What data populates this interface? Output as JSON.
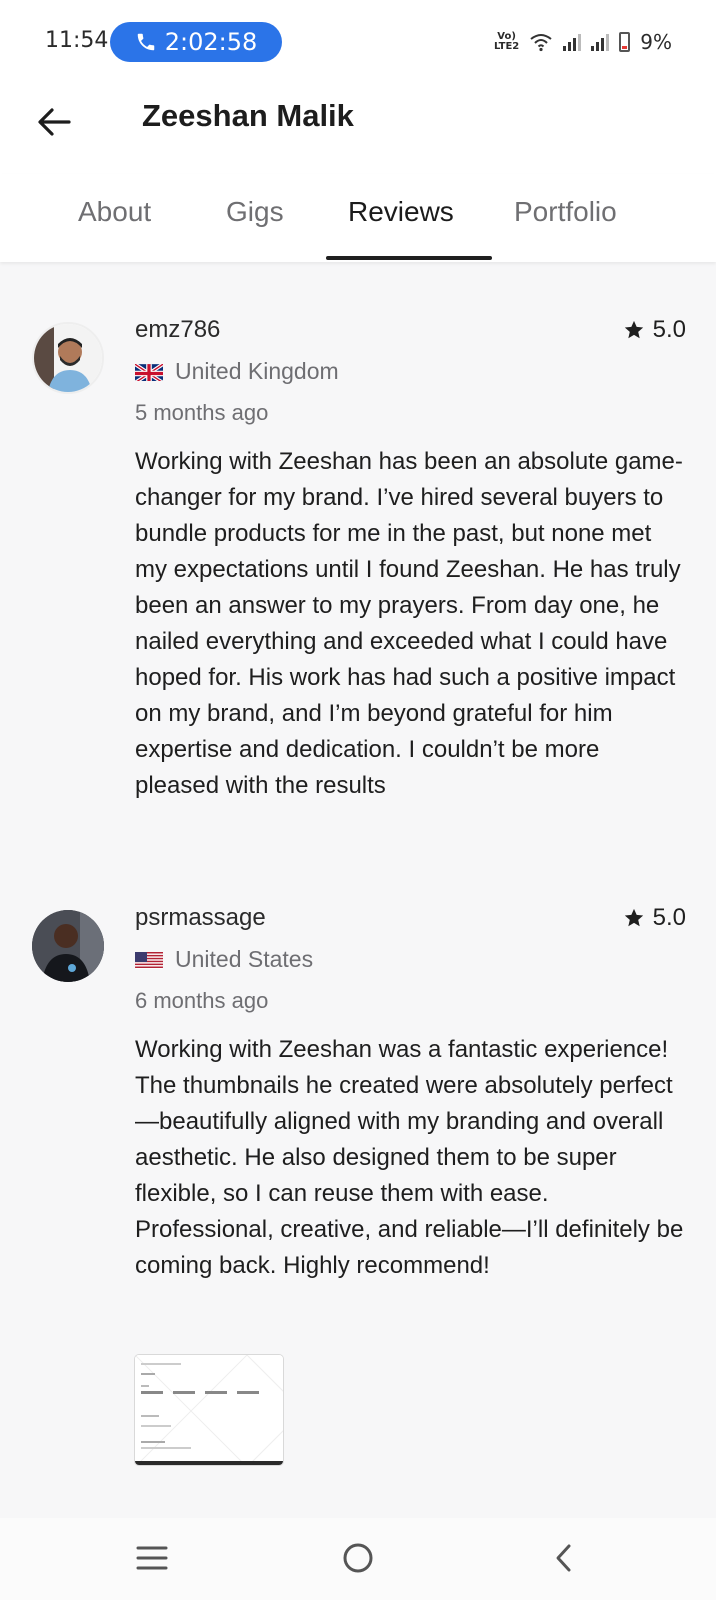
{
  "status_bar": {
    "time": "11:54",
    "call_timer": "2:02:58",
    "network_label": "VoLTE2",
    "battery": "9%"
  },
  "header": {
    "title": "Zeeshan Malik"
  },
  "tabs": [
    {
      "label": "About"
    },
    {
      "label": "Gigs"
    },
    {
      "label": "Reviews"
    },
    {
      "label": "Portfolio"
    }
  ],
  "active_tab": "Reviews",
  "reviews": [
    {
      "username": "emz786",
      "rating": "5.0",
      "country": "United Kingdom",
      "time_ago": "5 months ago",
      "text": "Working with Zeeshan has been an absolute game-changer for my brand. I’ve hired several buyers to bundle products for me in the past, but none met my expectations until I found Zeeshan. He has truly been an answer to my prayers. From day one, he nailed everything and exceeded what I could have hoped for. His work has had such a positive impact on my brand, and I’m beyond grateful for him expertise and dedication. I couldn’t be more pleased with the results"
    },
    {
      "username": "psrmassage",
      "rating": "5.0",
      "country": "United States",
      "time_ago": "6 months ago",
      "text": "Working with Zeeshan was a fantastic experience! The thumbnails he created were absolutely perfect—beautifully aligned with my branding and overall aesthetic. He also designed them to be super flexible, so I can reuse them with ease. Professional, creative, and reliable—I’ll definitely be coming back. Highly recommend!"
    }
  ],
  "colors": {
    "call_pill": "#2b74e8",
    "background": "#f7f7f8",
    "text_primary": "#1e1e1e",
    "text_secondary": "#6e6e72"
  }
}
